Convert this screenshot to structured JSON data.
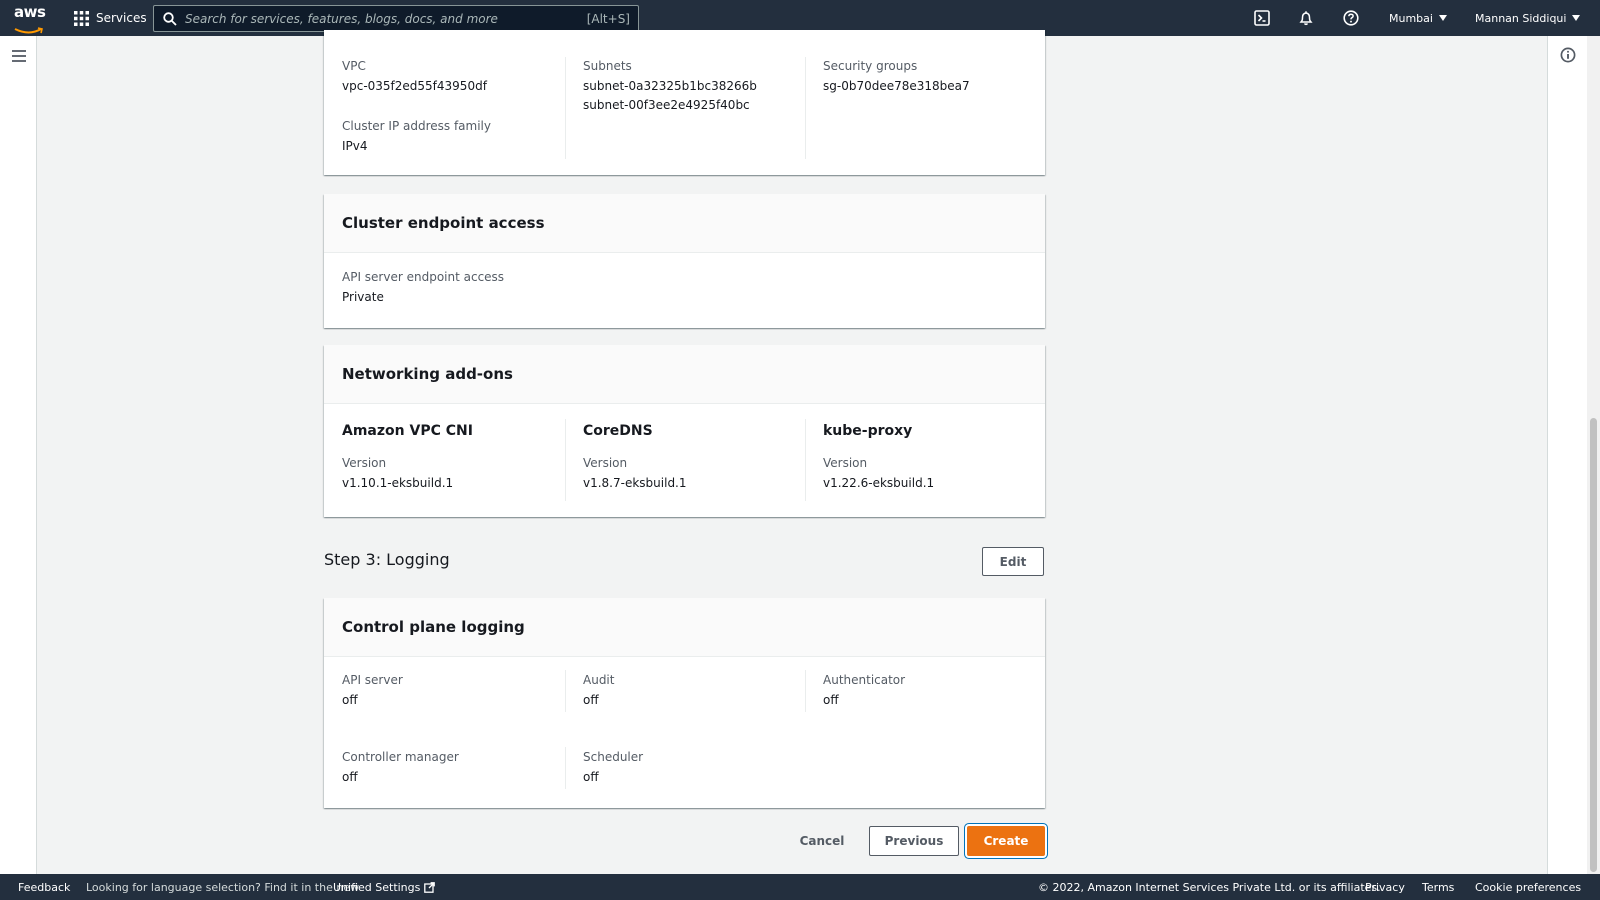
{
  "topnav": {
    "logo_text": "aws",
    "services_label": "Services",
    "search_placeholder": "Search for services, features, blogs, docs, and more",
    "search_shortcut": "[Alt+S]",
    "region": "Mumbai",
    "user": "Mannan Siddiqui",
    "icons": [
      "grid-icon",
      "search-icon",
      "cloudshell-icon",
      "bell-icon",
      "help-icon"
    ]
  },
  "networking": {
    "vpc_label": "VPC",
    "vpc_value": "vpc-035f2ed55f43950df",
    "ip_family_label": "Cluster IP address family",
    "ip_family_value": "IPv4",
    "subnets_label": "Subnets",
    "subnets": [
      "subnet-0a32325b1bc38266b",
      "subnet-00f3ee2e4925f40bc"
    ],
    "sg_label": "Security groups",
    "sg_value": "sg-0b70dee78e318bea7"
  },
  "endpoint": {
    "title": "Cluster endpoint access",
    "label": "API server endpoint access",
    "value": "Private"
  },
  "addons": {
    "title": "Networking add-ons",
    "items": [
      {
        "name": "Amazon VPC CNI",
        "version_label": "Version",
        "version": "v1.10.1-eksbuild.1"
      },
      {
        "name": "CoreDNS",
        "version_label": "Version",
        "version": "v1.8.7-eksbuild.1"
      },
      {
        "name": "kube-proxy",
        "version_label": "Version",
        "version": "v1.22.6-eksbuild.1"
      }
    ]
  },
  "step3": {
    "title": "Step 3: Logging",
    "edit_label": "Edit"
  },
  "logging": {
    "title": "Control plane logging",
    "items": [
      {
        "label": "API server",
        "value": "off"
      },
      {
        "label": "Audit",
        "value": "off"
      },
      {
        "label": "Authenticator",
        "value": "off"
      },
      {
        "label": "Controller manager",
        "value": "off"
      },
      {
        "label": "Scheduler",
        "value": "off"
      }
    ]
  },
  "actions": {
    "cancel": "Cancel",
    "previous": "Previous",
    "create": "Create"
  },
  "footer": {
    "feedback": "Feedback",
    "lang_note": "Looking for language selection? Find it in the new",
    "unified_settings": "Unified Settings",
    "copyright": "© 2022, Amazon Internet Services Private Ltd. or its affiliates.",
    "privacy": "Privacy",
    "terms": "Terms",
    "cookies": "Cookie preferences"
  },
  "colors": {
    "nav_bg": "#232f3e",
    "primary": "#ec7211",
    "focus": "#0073bb"
  }
}
